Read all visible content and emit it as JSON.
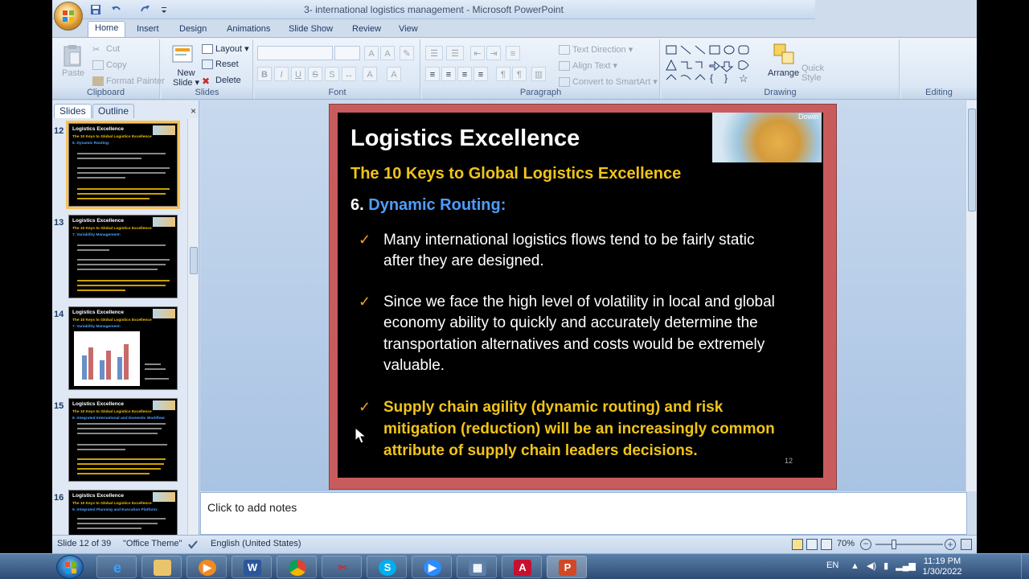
{
  "window": {
    "title": "3- international logistics management - Microsoft PowerPoint"
  },
  "ribbon": {
    "tabs": [
      "Home",
      "Insert",
      "Design",
      "Animations",
      "Slide Show",
      "Review",
      "View"
    ],
    "groups": {
      "clipboard": {
        "label": "Clipboard",
        "paste": "Paste",
        "cut": "Cut",
        "copy": "Copy",
        "format_painter": "Format Painter"
      },
      "slides": {
        "label": "Slides",
        "new_slide": "New",
        "new_slide_2": "Slide",
        "layout": "Layout",
        "reset": "Reset",
        "delete": "Delete"
      },
      "font": {
        "label": "Font"
      },
      "paragraph": {
        "label": "Paragraph",
        "text_direction": "Text Direction",
        "align_text": "Align Text",
        "convert_smartart": "Convert to SmartArt"
      },
      "drawing": {
        "label": "Drawing",
        "arrange": "Arrange",
        "quick_styles": "Quick",
        "quick_styles_2": "Style"
      },
      "editing": {
        "label": "Editing"
      }
    }
  },
  "left_pane": {
    "tabs": [
      "Slides",
      "Outline"
    ],
    "close_glyph": "×",
    "thumbnails": [
      {
        "number": "12",
        "title": "Logistics Excellence",
        "subtitle": "The 10 Keys to Global Logistics Excellence",
        "heading": "6. Dynamic Routing:",
        "selected": true
      },
      {
        "number": "13",
        "title": "Logistics Excellence",
        "subtitle": "The 10 Keys to Global Logistics Excellence",
        "heading": "7. Variability Management:",
        "selected": false
      },
      {
        "number": "14",
        "title": "Logistics Excellence",
        "subtitle": "The 10 Keys to Global Logistics Excellence",
        "heading": "7. Variability Management:",
        "selected": false
      },
      {
        "number": "15",
        "title": "Logistics Excellence",
        "subtitle": "The 10 Keys to Global Logistics Excellence",
        "heading": "8. Integrated International and Domestic Workflow:",
        "selected": false
      },
      {
        "number": "16",
        "title": "Logistics Excellence",
        "subtitle": "The 10 Keys to Global Logistics Excellence",
        "heading": "9. Integrated Planning and Execution Platform:",
        "selected": false
      }
    ]
  },
  "slide": {
    "title": "Logistics Excellence",
    "subtitle": "The 10 Keys to Global Logistics Excellence",
    "heading_num": "6.",
    "heading_text": "Dynamic Routing:",
    "image_label": "Dowin",
    "check_glyph": "✓",
    "bullets": [
      {
        "lines": [
          "Many international logistics flows tend to be fairly static",
          "after they are designed."
        ],
        "bold": false
      },
      {
        "lines": [
          "Since we face the high level of volatility in local and global",
          "economy ability to quickly and accurately determine the",
          "transportation alternatives and costs would be extremely",
          "valuable."
        ],
        "bold": false
      },
      {
        "lines": [
          "Supply chain agility (dynamic routing) and risk",
          "mitigation (reduction) will be an increasingly common",
          "attribute of supply chain leaders decisions."
        ],
        "bold": true
      }
    ],
    "page_number": "12"
  },
  "notes": {
    "placeholder": "Click to add notes"
  },
  "status": {
    "slide_info": "Slide 12 of 39",
    "theme": "\"Office Theme\"",
    "language": "English (United States)",
    "zoom": "70%"
  },
  "taskbar": {
    "apps": [
      "internet-explorer",
      "file-explorer",
      "media-player",
      "word",
      "chrome",
      "snipping-tool",
      "skype",
      "zoom",
      "video-editor",
      "acrobat",
      "powerpoint"
    ],
    "lang": "EN",
    "time": "11:19 PM",
    "date": "1/30/2022"
  }
}
